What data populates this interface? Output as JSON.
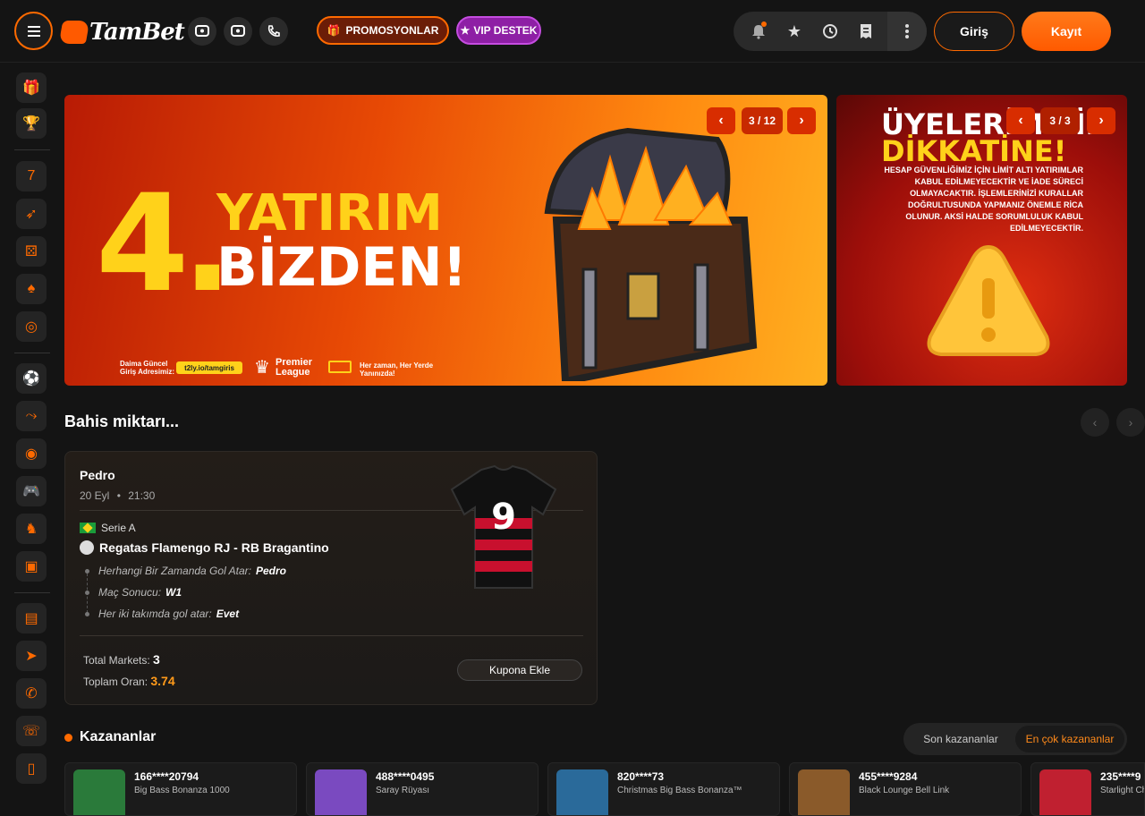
{
  "header": {
    "logo_text": "TamBet",
    "promo_label": "PROMOSYONLAR",
    "vip_label": "VIP DESTEK",
    "login_label": "Giriş",
    "register_label": "Kayıt",
    "icons": [
      "menu-icon",
      "chat-icon",
      "chat-bubble-icon",
      "phone-icon",
      "bell-icon",
      "star-icon",
      "history-icon",
      "receipt-icon",
      "more-icon"
    ]
  },
  "banner_main": {
    "line1": "4.",
    "line2": "YATIRIM",
    "line3": "BİZDEN!",
    "footer_addr": "Daima Güncel\nGiriş Adresimiz:",
    "footer_link": "t2ly.io/tamgiris",
    "footer_league": "Premier\nLeague",
    "footer_text": "Her zaman, Her Yerde\nYanınızda!",
    "counter": "3 / 12"
  },
  "banner_side": {
    "title1": "ÜYELERİMİZİN",
    "title2": "DİKKATİNE!",
    "text": "HESAP GÜVENLİĞİMİZ İÇİN LİMİT ALTI YATIRIMLAR KABUL EDİLMEYECEKTİR VE İADE SÜRECİ OLMAYACAKTIR. İŞLEMLERİNİZİ KURALLAR DOĞRULTUSUNDA YAPMANIZ ÖNEMLE RİCA OLUNUR. AKSİ HALDE SORUMLULUK KABUL EDİLMEYECEKTİR.",
    "counter": "3 / 3"
  },
  "bet_section": {
    "title": "Bahis miktarı...",
    "player": "Pedro",
    "date": "20 Eyl",
    "time": "21:30",
    "league": "Serie A",
    "match": "Regatas Flamengo RJ - RB Bragantino",
    "jersey_number": "9",
    "markets": [
      {
        "label": "Herhangi Bir Zamanda Gol Atar:",
        "value": "Pedro"
      },
      {
        "label": "Maç Sonucu:",
        "value": "W1"
      },
      {
        "label": "Her iki takımda gol atar:",
        "value": "Evet"
      }
    ],
    "total_markets_label": "Total Markets:",
    "total_markets_value": "3",
    "total_odds_label": "Toplam Oran:",
    "total_odds_value": "3.74",
    "add_button": "Kupona Ekle"
  },
  "winners": {
    "title": "Kazananlar",
    "tabs": [
      "Son kazananlar",
      "En çok kazananlar"
    ],
    "active_tab": "En çok kazananlar",
    "items": [
      {
        "user": "166****20794",
        "game": "Big Bass Bonanza 1000",
        "color": "#2a7a3a"
      },
      {
        "user": "488****0495",
        "game": "Saray Rüyası",
        "color": "#7a4ac0"
      },
      {
        "user": "820****73",
        "game": "Christmas Big Bass Bonanza™",
        "color": "#2a6a9a"
      },
      {
        "user": "455****9284",
        "game": "Black Lounge Bell Link",
        "color": "#8a5a2a"
      },
      {
        "user": "235****9",
        "game": "Starlight Ch",
        "color": "#c02030"
      }
    ]
  },
  "colors": {
    "accent": "#ff6a00",
    "vip": "#8e1fa5",
    "background": "#141414"
  }
}
